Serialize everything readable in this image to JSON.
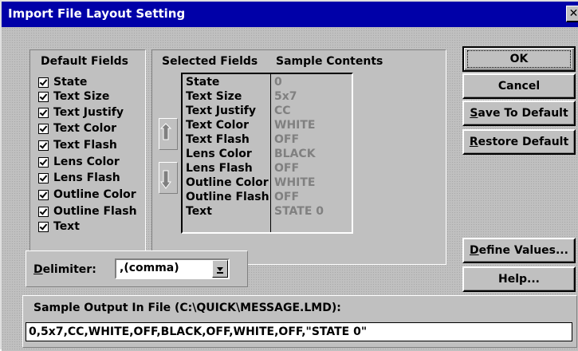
{
  "window": {
    "title": "Import File Layout Setting",
    "close_glyph": "✕"
  },
  "default_fields": {
    "header": "Default Fields",
    "items": [
      {
        "label": "State",
        "checked": true
      },
      {
        "label": "Text Size",
        "checked": true
      },
      {
        "label": "Text Justify",
        "checked": true
      },
      {
        "label": "Text Color",
        "checked": true
      },
      {
        "label": "Text Flash",
        "checked": true
      },
      {
        "label": "Lens Color",
        "checked": true
      },
      {
        "label": "Lens Flash",
        "checked": true
      },
      {
        "label": "Outline Color",
        "checked": true
      },
      {
        "label": "Outline Flash",
        "checked": true
      },
      {
        "label": "Text",
        "checked": true
      }
    ]
  },
  "selected_fields": {
    "header_fields": "Selected Fields",
    "header_samples": "Sample Contents",
    "rows": [
      {
        "field": "State",
        "sample": "0"
      },
      {
        "field": "Text Size",
        "sample": "5x7"
      },
      {
        "field": "Text Justify",
        "sample": "CC"
      },
      {
        "field": "Text Color",
        "sample": "WHITE"
      },
      {
        "field": "Text Flash",
        "sample": "OFF"
      },
      {
        "field": "Lens Color",
        "sample": "BLACK"
      },
      {
        "field": "Lens Flash",
        "sample": "OFF"
      },
      {
        "field": "Outline Color",
        "sample": "WHITE"
      },
      {
        "field": "Outline Flash",
        "sample": "OFF"
      },
      {
        "field": "Text",
        "sample": "STATE 0"
      }
    ]
  },
  "buttons": {
    "ok": "OK",
    "cancel": "Cancel",
    "save_to_default": "Save To Default",
    "restore_default": "Restore Default",
    "define_values": "Define Values...",
    "help": "Help..."
  },
  "delimiter": {
    "label": "Delimiter:",
    "value": ",(comma)"
  },
  "sample_output": {
    "label": "Sample Output In File (C:\\QUICK\\MESSAGE.LMD):",
    "value": "0,5x7,CC,WHITE,OFF,BLACK,OFF,WHITE,OFF,\"STATE 0\""
  },
  "colors": {
    "titlebar": "#0000a8",
    "face": "#c0c0c0",
    "disabled_text": "#808080"
  }
}
